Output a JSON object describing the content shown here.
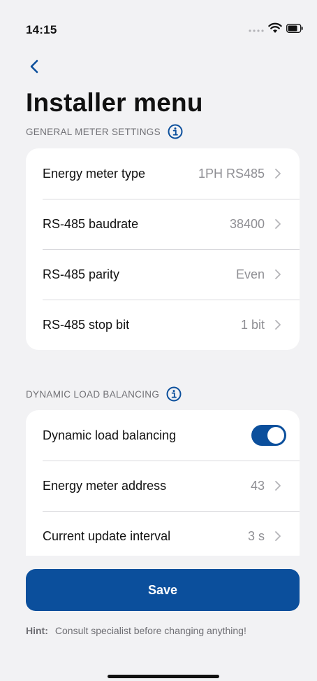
{
  "status_bar": {
    "time": "14:15",
    "icons": [
      "signal-dots-icon",
      "wifi-icon",
      "battery-icon"
    ]
  },
  "navigation": {
    "back_icon": "chevron-left-icon",
    "title": "Installer menu"
  },
  "general_meter_settings": {
    "header": "GENERAL METER SETTINGS",
    "info_icon": "info-circle-icon",
    "rows": [
      {
        "label": "Energy meter type",
        "value": "1PH RS485"
      },
      {
        "label": "RS-485 baudrate",
        "value": "38400"
      },
      {
        "label": "RS-485 parity",
        "value": "Even"
      },
      {
        "label": "RS-485 stop bit",
        "value": "1 bit"
      }
    ]
  },
  "dynamic_load_balancing": {
    "header": "DYNAMIC LOAD BALANCING",
    "info_icon": "info-circle-icon",
    "toggle_row": {
      "label": "Dynamic load balancing",
      "enabled": true
    },
    "rows": [
      {
        "label": "Energy meter address",
        "value": "43"
      },
      {
        "label": "Current update interval",
        "value": "3 s"
      }
    ]
  },
  "save_button": {
    "label": "Save"
  },
  "hint": {
    "label": "Hint:",
    "text": "Consult specialist before changing anything!"
  },
  "colors": {
    "accent": "#0b4f9c",
    "background": "#f2f2f4",
    "card": "#ffffff",
    "secondary_text": "#8e8e93"
  }
}
